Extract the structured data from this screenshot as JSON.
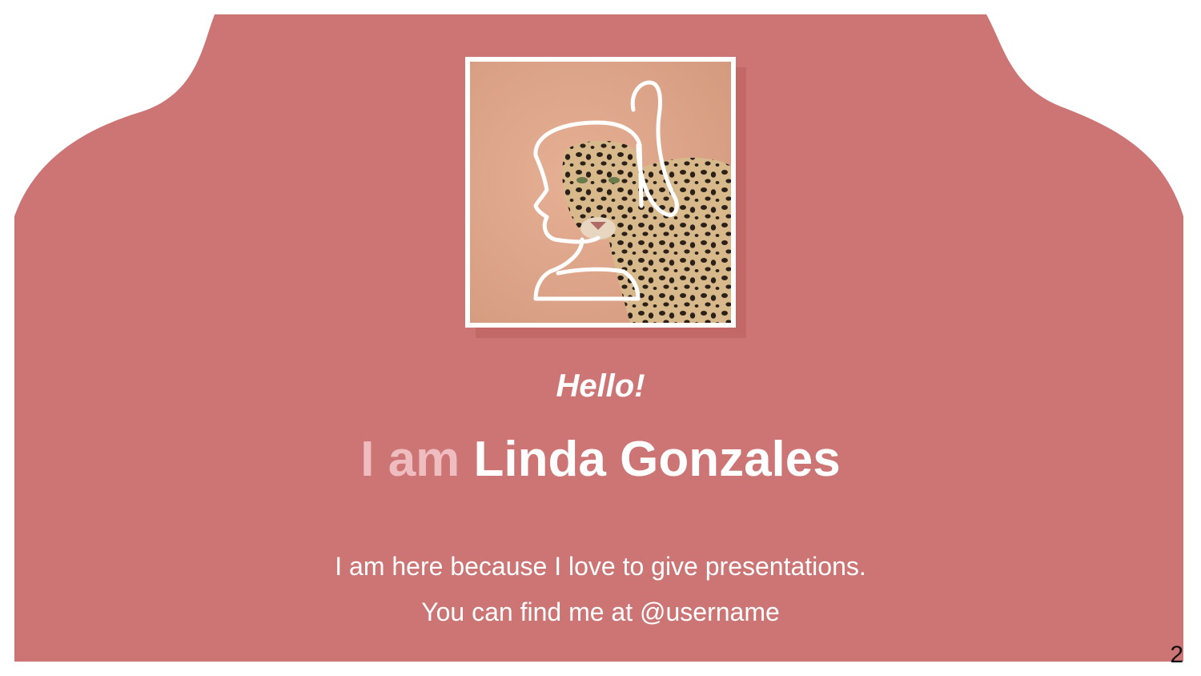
{
  "slide": {
    "greeting": "Hello!",
    "name_prefix": "I am",
    "name": "Linda Gonzales",
    "body_line_1": "I am here because I love to give presentations.",
    "body_line_2": "You can find me at @username",
    "page_number": "2"
  },
  "colors": {
    "background_shape": "#cc7574",
    "name_prefix": "#efbcc0",
    "text": "#ffffff",
    "photo_frame": "#ffffff"
  },
  "icons": {
    "avatar_outline": "woman-profile-ponytail-icon"
  }
}
